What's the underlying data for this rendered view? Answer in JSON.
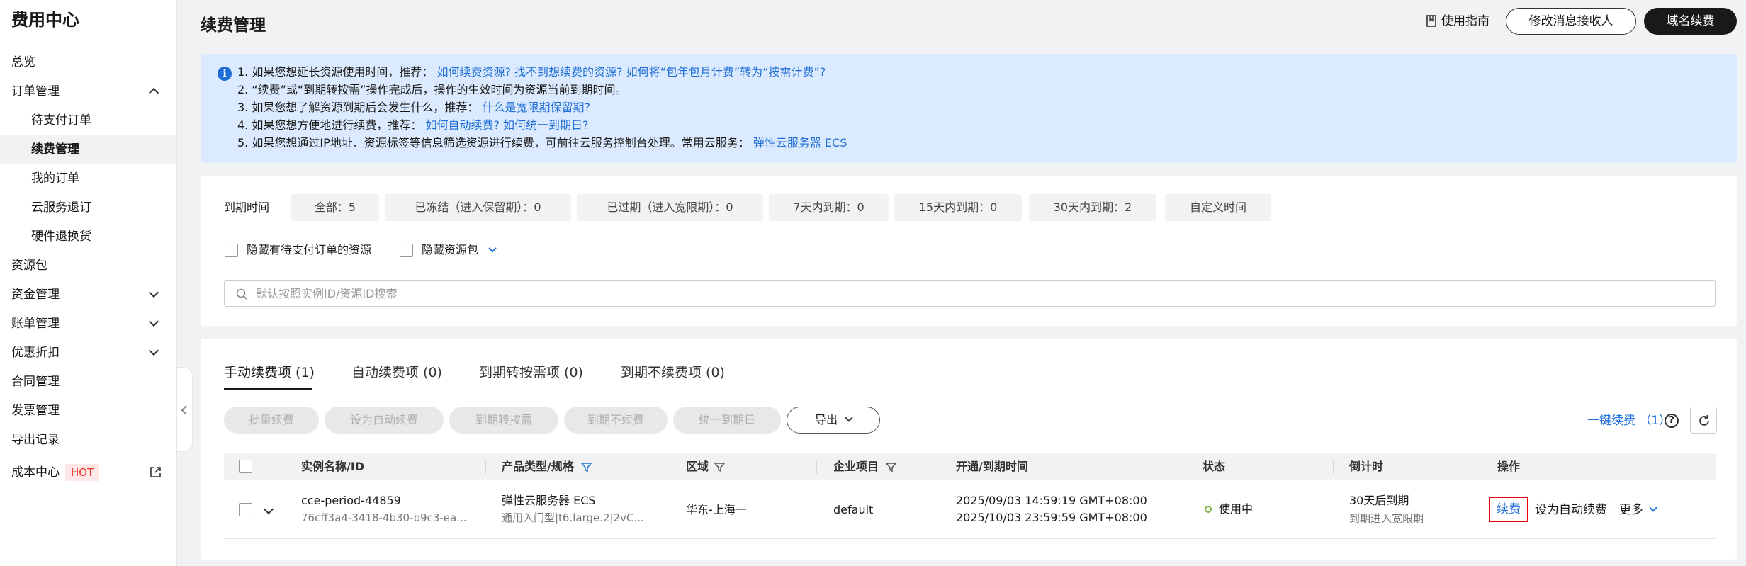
{
  "sidebar": {
    "title": "费用中心",
    "items": [
      {
        "label": "总览"
      },
      {
        "label": "订单管理"
      },
      {
        "label": "待支付订单"
      },
      {
        "label": "续费管理"
      },
      {
        "label": "我的订单"
      },
      {
        "label": "云服务退订"
      },
      {
        "label": "硬件退换货"
      },
      {
        "label": "资源包"
      },
      {
        "label": "资金管理"
      },
      {
        "label": "账单管理"
      },
      {
        "label": "优惠折扣"
      },
      {
        "label": "合同管理"
      },
      {
        "label": "发票管理"
      },
      {
        "label": "导出记录"
      },
      {
        "label": "成本中心",
        "badge": "HOT"
      }
    ]
  },
  "header": {
    "title": "续费管理",
    "guide": "使用指南",
    "modify_receiver": "修改消息接收人",
    "domain_renew": "域名续费"
  },
  "notice": {
    "l1_text": "1. 如果您想延长资源使用时间，推荐：",
    "l1_link1": "如何续费资源?",
    "l1_link2": "找不到想续费的资源?",
    "l1_link3": "如何将“包年包月计费”转为“按需计费”?",
    "l2_text": "2. “续费”或“到期转按需”操作完成后，操作的生效时间为资源当前到期时间。",
    "l3_text": "3. 如果您想了解资源到期后会发生什么，推荐：",
    "l3_link": "什么是宽限期保留期?",
    "l4_text": "4. 如果您想方便地进行续费，推荐：",
    "l4_link1": "如何自动续费?",
    "l4_link2": "如何统一到期日?",
    "l5_text": "5. 如果您想通过IP地址、资源标签等信息筛选资源进行续费，可前往云服务控制台处理。常用云服务：",
    "l5_link": "弹性云服务器 ECS"
  },
  "filter": {
    "label": "到期时间",
    "chips": [
      "全部：5",
      "已冻结（进入保留期）：0",
      "已过期（进入宽限期）：0",
      "7天内到期：0",
      "15天内到期：0",
      "30天内到期：2",
      "自定义时间"
    ],
    "hide_pending": "隐藏有待支付订单的资源",
    "hide_package": "隐藏资源包",
    "search_placeholder": "默认按照实例ID/资源ID搜索"
  },
  "tabs": [
    {
      "label": "手动续费项 (1)"
    },
    {
      "label": "自动续费项 (0)"
    },
    {
      "label": "到期转按需项 (0)"
    },
    {
      "label": "到期不续费项 (0)"
    }
  ],
  "actions": {
    "batch_renew": "批量续费",
    "set_auto": "设为自动续费",
    "to_on_demand": "到期转按需",
    "no_renew": "到期不续费",
    "unify_date": "统一到期日",
    "export": "导出",
    "one_click": "一键续费 （1）"
  },
  "table": {
    "headers": [
      "实例名称/ID",
      "产品类型/规格",
      "区域",
      "企业项目",
      "开通/到期时间",
      "状态",
      "倒计时",
      "操作"
    ],
    "rows": [
      {
        "name": "cce-period-44859",
        "id": "76cff3a4-3418-4b30-b9c3-ea...",
        "product": "弹性云服务器 ECS",
        "spec": "通用入门型|t6.large.2|2vC...",
        "region": "华东-上海一",
        "project": "default",
        "start": "2025/09/03 14:59:19 GMT+08:00",
        "end": "2025/10/03 23:59:59 GMT+08:00",
        "status": "使用中",
        "countdown": "30天后到期",
        "countdown_note": "到期进入宽限期",
        "op_renew": "续费",
        "op_auto": "设为自动续费",
        "op_more": "更多"
      }
    ]
  },
  "colors": {
    "link": "#1f6fd6",
    "highlight_border": "#e8000b",
    "status_ok": "#7bb843",
    "hot": "#e8362c"
  }
}
